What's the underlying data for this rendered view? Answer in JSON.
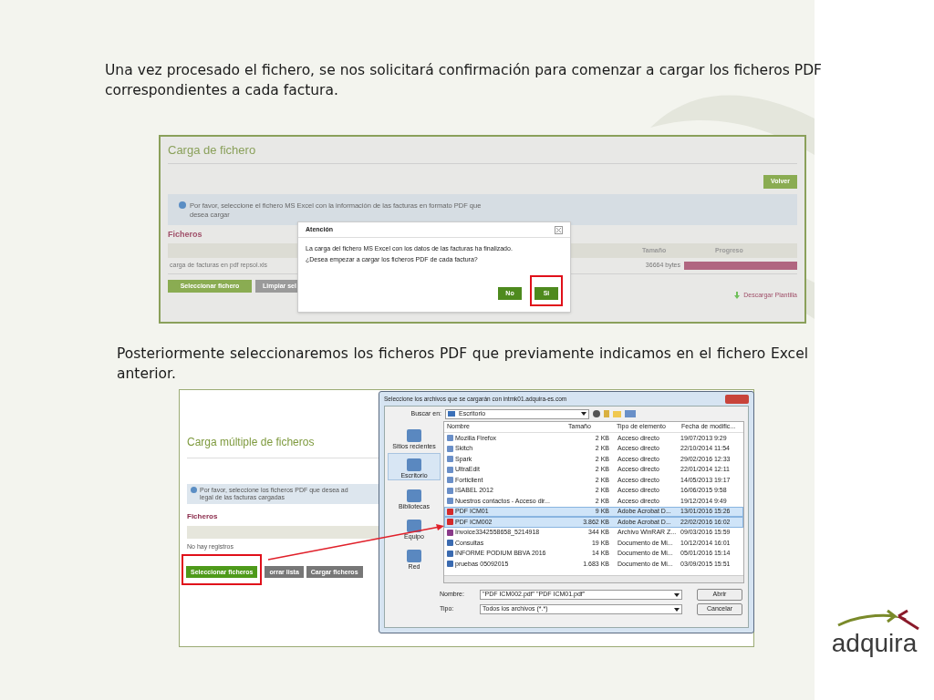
{
  "intro_text": "Una vez procesado el fichero, se nos solicitará confirmación para comenzar a cargar los ficheros PDF correspondientes a cada factura.",
  "screenshot_1": {
    "title": "Carga de fichero",
    "back_button": "Volver",
    "info": "Por favor, seleccione el fichero MS Excel con la información de las facturas en formato PDF que desea cargar",
    "section": "Ficheros",
    "columns": [
      "Tamaño",
      "Progreso"
    ],
    "rows": [
      {
        "file": "carga de facturas en pdf repsol.xls",
        "size": "36664 bytes",
        "level": 1
      }
    ],
    "buttons": [
      {
        "label": "Seleccionar fichero",
        "kind": "primary"
      },
      {
        "label": "Limpiar sel",
        "kind": "secondary"
      }
    ],
    "download_link": "Descargar Plantilla",
    "dialog": {
      "title": "Atención",
      "message": [
        "La carga del fichero MS Excel con los datos de las facturas ha finalizado.",
        "¿Desea empezar a cargar los ficheros PDF de cada factura?"
      ],
      "buttons": [
        {
          "label": "No",
          "highlighted": false
        },
        {
          "label": "Si",
          "highlighted": true
        }
      ]
    }
  },
  "text_2": "Posteriormente seleccionaremos los ficheros PDF que previamente indicamos en el fichero Excel anterior.",
  "screenshot_2": {
    "title": "Carga múltiple de ficheros",
    "info": [
      "Por favor, seleccione los ficheros PDF que desea ad",
      "legal de las facturas cargadas"
    ],
    "section": "Ficheros",
    "empty": "No hay registros",
    "buttons": [
      {
        "label": "Seleccionar ficheros",
        "kind": "primary",
        "highlighted": true
      },
      {
        "label": "orrar lista",
        "kind": "secondary",
        "highlighted": false
      },
      {
        "label": "Cargar ficheros",
        "kind": "secondary",
        "highlighted": false
      }
    ],
    "file_dialog": {
      "title": "Seleccione los archivos que se cargarán con intmk01.adquira-es.com",
      "look_in_label": "Buscar en:",
      "look_in": "Escritorio",
      "places": [
        {
          "label": "Sitios recientes",
          "selected": false
        },
        {
          "label": "Escritorio",
          "selected": true
        },
        {
          "label": "Bibliotecas",
          "selected": false
        },
        {
          "label": "Equipo",
          "selected": false
        },
        {
          "label": "Red",
          "selected": false
        }
      ],
      "columns": [
        "Nombre",
        "Tamaño",
        "Tipo de elemento",
        "Fecha de modific..."
      ],
      "files": [
        {
          "name": "Mozilla Firefox",
          "size": "2 KB",
          "type": "Acceso directo",
          "date": "19/07/2013 9:29",
          "kind": "shortcut",
          "selected": false
        },
        {
          "name": "Skitch",
          "size": "2 KB",
          "type": "Acceso directo",
          "date": "22/10/2014 11:54",
          "kind": "shortcut",
          "selected": false
        },
        {
          "name": "Spark",
          "size": "2 KB",
          "type": "Acceso directo",
          "date": "29/02/2016 12:33",
          "kind": "shortcut",
          "selected": false
        },
        {
          "name": "UltraEdit",
          "size": "2 KB",
          "type": "Acceso directo",
          "date": "22/01/2014 12:11",
          "kind": "shortcut",
          "selected": false
        },
        {
          "name": "Forticlient",
          "size": "2 KB",
          "type": "Acceso directo",
          "date": "14/05/2013 19:17",
          "kind": "shortcut",
          "selected": false
        },
        {
          "name": "ISABEL 2012",
          "size": "2 KB",
          "type": "Acceso directo",
          "date": "16/06/2015 9:58",
          "kind": "shortcut",
          "selected": false
        },
        {
          "name": "Nuestros contactos - Acceso dir...",
          "size": "2 KB",
          "type": "Acceso directo",
          "date": "19/12/2014 9:49",
          "kind": "shortcut",
          "selected": false
        },
        {
          "name": "PDF ICM01",
          "size": "9 KB",
          "type": "Adobe Acrobat D...",
          "date": "13/01/2016 15:26",
          "kind": "pdf",
          "selected": true
        },
        {
          "name": "PDF ICM002",
          "size": "3.862 KB",
          "type": "Adobe Acrobat D...",
          "date": "22/02/2016 16:02",
          "kind": "pdf",
          "selected": true
        },
        {
          "name": "Invoice3342558658_5214918",
          "size": "344 KB",
          "type": "Archivo WinRAR Z...",
          "date": "09/03/2016 15:59",
          "kind": "archive",
          "selected": false
        },
        {
          "name": "Consultas",
          "size": "19 KB",
          "type": "Documento de Mi...",
          "date": "10/12/2014 16:01",
          "kind": "document",
          "selected": false
        },
        {
          "name": "INFORME PODIUM BBVA 2016",
          "size": "14 KB",
          "type": "Documento de Mi...",
          "date": "05/01/2016 15:14",
          "kind": "document",
          "selected": false
        },
        {
          "name": "pruebas 05092015",
          "size": "1.683 KB",
          "type": "Documento de Mi...",
          "date": "03/09/2015 15:51",
          "kind": "document",
          "selected": false
        }
      ],
      "name_label": "Nombre:",
      "name_value": "\"PDF ICM002.pdf\" \"PDF ICM01.pdf\"",
      "type_label": "Tipo:",
      "type_value": "Todos los archivos (*.*)",
      "open_button": "Abrir",
      "cancel_button": "Cancelar"
    }
  },
  "logo": {
    "text": "adquira"
  }
}
